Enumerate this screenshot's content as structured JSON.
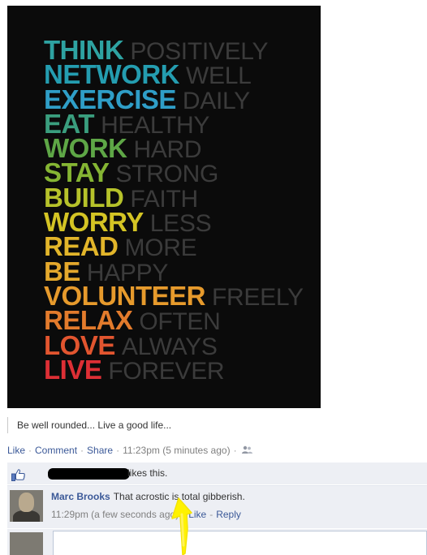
{
  "poster": {
    "lines": [
      {
        "bold": "THINK",
        "light": "POSITIVELY",
        "color": "#2ea3a2"
      },
      {
        "bold": "NETWORK",
        "light": "WELL",
        "color": "#249db0"
      },
      {
        "bold": "EXERCISE",
        "light": "DAILY",
        "color": "#2f9ec7"
      },
      {
        "bold": "EAT",
        "light": "HEALTHY",
        "color": "#3a9e7e"
      },
      {
        "bold": "WORK",
        "light": "HARD",
        "color": "#5ea646"
      },
      {
        "bold": "STAY",
        "light": "STRONG",
        "color": "#85b533"
      },
      {
        "bold": "BUILD",
        "light": "FAITH",
        "color": "#b6c22a"
      },
      {
        "bold": "WORRY",
        "light": "LESS",
        "color": "#d4c424"
      },
      {
        "bold": "READ",
        "light": "MORE",
        "color": "#e2b52a"
      },
      {
        "bold": "BE",
        "light": "HAPPY",
        "color": "#e4a82c"
      },
      {
        "bold": "VOLUNTEER",
        "light": "FREELY",
        "color": "#e69a2c"
      },
      {
        "bold": "RELAX",
        "light": "OFTEN",
        "color": "#e37b2c"
      },
      {
        "bold": "LOVE",
        "light": "ALWAYS",
        "color": "#e2552f"
      },
      {
        "bold": "LIVE",
        "light": "FOREVER",
        "color": "#dd2f35"
      }
    ]
  },
  "caption": "Be well rounded... Live a good life...",
  "actions": {
    "like": "Like",
    "comment": "Comment",
    "share": "Share",
    "timestamp": "11:23pm (5 minutes ago)",
    "separator": "·",
    "audience_icon": "people-icon"
  },
  "likes": {
    "text": "likes this.",
    "icon": "thumbs-up-icon"
  },
  "comment": {
    "author": "Marc Brooks",
    "text": "That acrostic is total gibberish.",
    "timestamp": "11:29pm (a few seconds ago)",
    "like": "Like",
    "reply": "Reply",
    "separator": "·",
    "dash": "-"
  },
  "colors": {
    "link": "#3b5998",
    "ufi_background": "#edeff4",
    "annotation_arrow": "#fff200"
  }
}
